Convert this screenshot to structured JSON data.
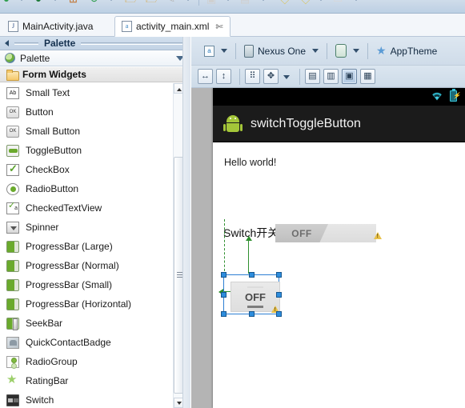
{
  "window": {
    "toolbar_icons": [
      "back-icon",
      "debug-icon",
      "layout-icon",
      "refresh-icon",
      "open-folder-icon",
      "open-folder-alt-icon",
      "brush-icon",
      "help-icon",
      "bookmark-icon",
      "tag-icon",
      "tag-alt-icon",
      "comment-icon"
    ]
  },
  "tabs": [
    {
      "label": "MainActivity.java",
      "icon": "java-file-icon",
      "icon_glyph": "J",
      "active": false,
      "closable": false
    },
    {
      "label": "activity_main.xml",
      "icon": "xml-file-icon",
      "icon_glyph": "a",
      "active": true,
      "closable": true,
      "close_glyph": "✄"
    }
  ],
  "palette": {
    "panel_title": "Palette",
    "header_label": "Palette",
    "header_icon": "palette-globe-icon",
    "collapse_arrow": "collapse-left-arrow",
    "chevron": "chevron-down-icon",
    "group": {
      "label": "Form Widgets",
      "icon": "folder-icon"
    },
    "items": [
      {
        "label": "Small Text",
        "icon": "small-text-icon",
        "glyph": "Ab"
      },
      {
        "label": "Button",
        "icon": "button-icon",
        "glyph": "OK"
      },
      {
        "label": "Small Button",
        "icon": "small-button-icon",
        "glyph": "OK"
      },
      {
        "label": "ToggleButton",
        "icon": "toggle-button-icon",
        "glyph": ""
      },
      {
        "label": "CheckBox",
        "icon": "checkbox-icon",
        "glyph": ""
      },
      {
        "label": "RadioButton",
        "icon": "radio-button-icon",
        "glyph": ""
      },
      {
        "label": "CheckedTextView",
        "icon": "checked-text-view-icon",
        "glyph": "a"
      },
      {
        "label": "Spinner",
        "icon": "spinner-icon",
        "glyph": ""
      },
      {
        "label": "ProgressBar (Large)",
        "icon": "progress-bar-large-icon",
        "glyph": ""
      },
      {
        "label": "ProgressBar (Normal)",
        "icon": "progress-bar-normal-icon",
        "glyph": ""
      },
      {
        "label": "ProgressBar (Small)",
        "icon": "progress-bar-small-icon",
        "glyph": ""
      },
      {
        "label": "ProgressBar (Horizontal)",
        "icon": "progress-bar-horizontal-icon",
        "glyph": ""
      },
      {
        "label": "SeekBar",
        "icon": "seek-bar-icon",
        "glyph": ""
      },
      {
        "label": "QuickContactBadge",
        "icon": "quick-contact-badge-icon",
        "glyph": ""
      },
      {
        "label": "RadioGroup",
        "icon": "radio-group-icon",
        "glyph": ""
      },
      {
        "label": "RatingBar",
        "icon": "rating-bar-icon",
        "glyph": ""
      },
      {
        "label": "Switch",
        "icon": "switch-icon",
        "glyph": ""
      }
    ],
    "scrollbar": {
      "up_arrow": "scroll-up-arrow",
      "down_arrow": "scroll-down-arrow"
    }
  },
  "designer": {
    "toolbar_primary": {
      "config_icon": "layout-config-icon",
      "config_glyph": "a",
      "device_label": "Nexus One",
      "device_icon": "device-icon",
      "orientation_icon": "orientation-portrait-icon",
      "theme_label": "AppTheme",
      "theme_icon": "theme-star-icon"
    },
    "toolbar_secondary": {
      "buttons": [
        {
          "name": "match-width-icon",
          "glyph": "↔",
          "selected": false
        },
        {
          "name": "match-height-icon",
          "glyph": "↕",
          "selected": false
        },
        {
          "name": "margins-icon",
          "glyph": "⠿",
          "selected": false
        },
        {
          "name": "distribute-icon",
          "glyph": "✥",
          "selected": false
        },
        {
          "name": "distribute-dropdown-caret",
          "glyph": "",
          "selected": false
        },
        {
          "name": "align-left-icon",
          "glyph": "▤",
          "selected": false
        },
        {
          "name": "align-top-icon",
          "glyph": "▥",
          "selected": false
        },
        {
          "name": "align-baseline-icon",
          "glyph": "▣",
          "selected": true
        },
        {
          "name": "align-wrap-icon",
          "glyph": "▦",
          "selected": false
        }
      ]
    }
  },
  "preview": {
    "statusbar": {
      "wifi_icon": "wifi-icon",
      "battery_icon": "battery-charging-icon",
      "battery_glyph": "⚡"
    },
    "app_title": "switchToggleButton",
    "app_icon": "android-robot-icon",
    "hello_text": "Hello world!",
    "switch_row": {
      "label": "Switch开关",
      "switch_state": "OFF",
      "warning_icon": "warning-triangle-icon"
    },
    "toggle_button": {
      "label": "OFF",
      "selected": true,
      "warning_icon": "warning-triangle-icon"
    }
  },
  "colors": {
    "chrome": "#cfdcea",
    "selection": "#2d8ddd",
    "guide_green": "#2f8f2f",
    "android_green": "#a4c639",
    "status_teal": "#39c2d6",
    "canvas_gray": "#b4b4b4"
  }
}
